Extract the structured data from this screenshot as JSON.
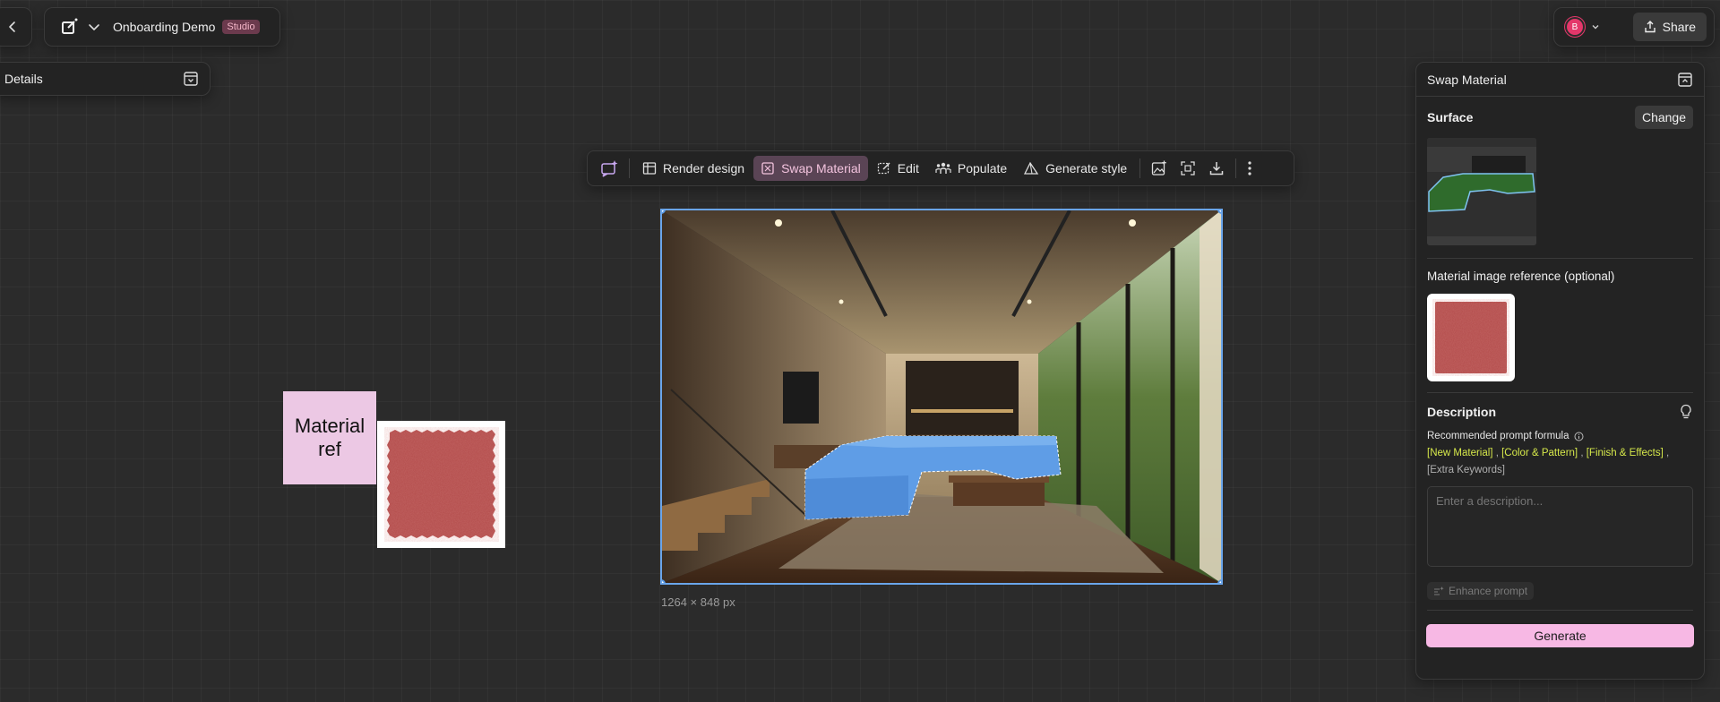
{
  "project": {
    "name": "Onboarding Demo",
    "badge": "Studio"
  },
  "details_panel": {
    "title": "Details"
  },
  "header_right": {
    "avatar_initial": "B",
    "share_label": "Share"
  },
  "toolbar": {
    "render_design": "Render design",
    "swap_material": "Swap Material",
    "edit": "Edit",
    "populate": "Populate",
    "generate_style": "Generate style"
  },
  "canvas": {
    "dimensions": "1264 × 848 px"
  },
  "material_ref": {
    "label_line1": "Material",
    "label_line2": "ref"
  },
  "panel": {
    "title": "Swap Material",
    "surface_title": "Surface",
    "change_label": "Change",
    "material_ref_title": "Material image reference (optional)",
    "description_title": "Description",
    "formula_title": "Recommended prompt formula",
    "formula_parts": [
      "[New Material]",
      "[Color & Pattern]",
      "[Finish & Effects]",
      "[Extra Keywords]"
    ],
    "formula_sep": ",",
    "description_placeholder": "Enter a description...",
    "enhance_label": "Enhance prompt",
    "generate_label": "Generate"
  },
  "colors": {
    "accent_pink": "#f7b8e4",
    "selection_blue": "#6aa5ea",
    "formula_yellow": "#d6e84a"
  }
}
